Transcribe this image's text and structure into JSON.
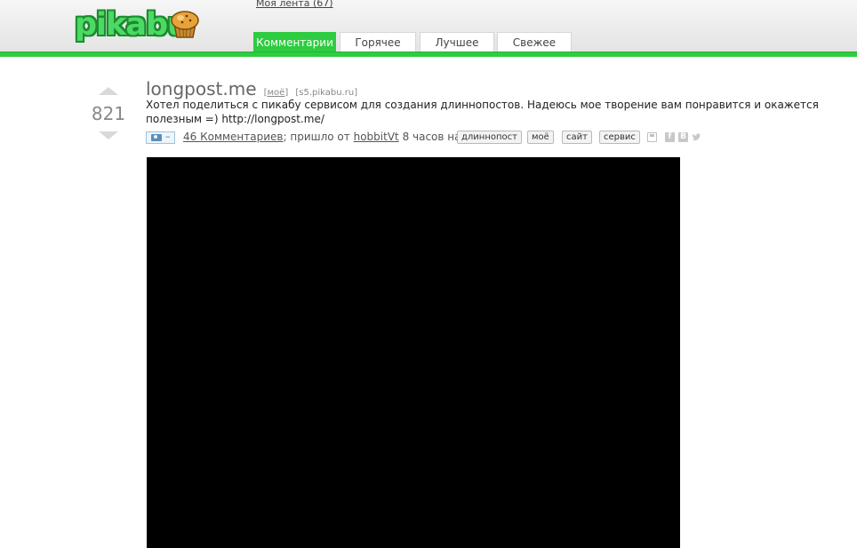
{
  "header": {
    "logo_text": "pikabu",
    "my_feed": "Моя лента (67)",
    "tabs": [
      {
        "label": "Комментарии",
        "active": true
      },
      {
        "label": "Горячее",
        "active": false
      },
      {
        "label": "Лучшее",
        "active": false
      },
      {
        "label": "Свежее",
        "active": false
      }
    ]
  },
  "post": {
    "rating": "821",
    "title": "longpost.me",
    "mine_link": "моё",
    "source": "s5.pikabu.ru",
    "description": "Хотел поделиться с пикабу сервисом для создания длиннопостов. Надеюсь мое творение вам понравится и окажется полезным =) http://longpost.me/",
    "media_badge": "–",
    "comments": "46 Комментариев",
    "came_from": "; пришло от",
    "author": "hobbitVt",
    "time": "8 часов назад",
    "tags": [
      "длиннопост",
      "моё",
      "сайт",
      "сервис"
    ],
    "share_icons": {
      "save": "save-icon",
      "facebook": "f",
      "vk": "B",
      "twitter": "twitter-icon"
    }
  },
  "colors": {
    "accent": "#2ecc40",
    "logo_green": "#4cd964",
    "video_bg": "#000000"
  }
}
